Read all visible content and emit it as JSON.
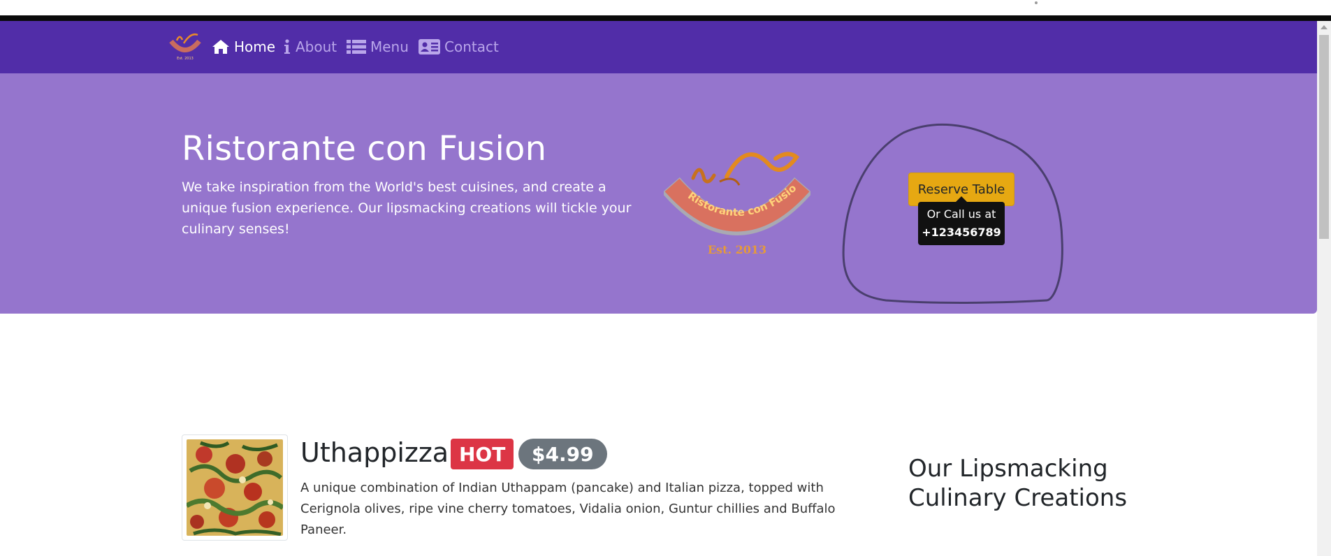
{
  "nav": {
    "items": [
      {
        "label": "Home",
        "icon": "home-icon",
        "active": true
      },
      {
        "label": "About",
        "icon": "info-icon",
        "active": false
      },
      {
        "label": "Menu",
        "icon": "list-icon",
        "active": false
      },
      {
        "label": "Contact",
        "icon": "address-card-icon",
        "active": false
      }
    ]
  },
  "hero": {
    "title": "Ristorante con Fusion",
    "description": "We take inspiration from the World's best cuisines, and create a unique fusion experience. Our lipsmacking creations will tickle your culinary senses!",
    "logo_text": "Ristorante con Fusion",
    "logo_est": "Est. 2013",
    "reserve_label": "Reserve Table",
    "tooltip_line1": "Or Call us at",
    "tooltip_phone": "+123456789"
  },
  "dish": {
    "name": "Uthappizza",
    "badge": "HOT",
    "price": "$4.99",
    "description": "A unique combination of Indian Uthappam (pancake) and Italian pizza, topped with Cerignola olives, ripe vine cherry tomatoes, Vidalia onion, Guntur chillies and Buffalo Paneer."
  },
  "side": {
    "heading": "Our Lipsmacking Culinary Creations"
  },
  "colors": {
    "navbar": "#512da8",
    "jumbotron": "#9575cd",
    "reserve_button": "#e6a812",
    "badge_hot": "#dc3545",
    "badge_price": "#6c757d"
  }
}
